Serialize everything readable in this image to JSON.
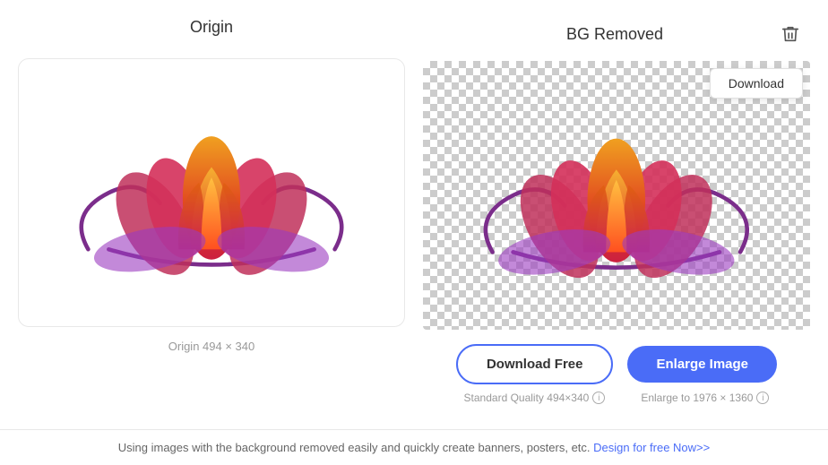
{
  "left_panel": {
    "title": "Origin",
    "caption": "Origin 494 × 340"
  },
  "right_panel": {
    "title": "BG Removed",
    "download_overlay_label": "Download",
    "download_free_label": "Download Free",
    "enlarge_label": "Enlarge Image",
    "standard_quality_text": "Standard Quality 494×340",
    "enlarge_text": "Enlarge to 1976 × 1360"
  },
  "footer": {
    "text": "Using images with the background removed easily and quickly create banners, posters, etc.",
    "link_text": "Design for free Now>>"
  },
  "icons": {
    "trash": "🗑",
    "info": "i"
  }
}
